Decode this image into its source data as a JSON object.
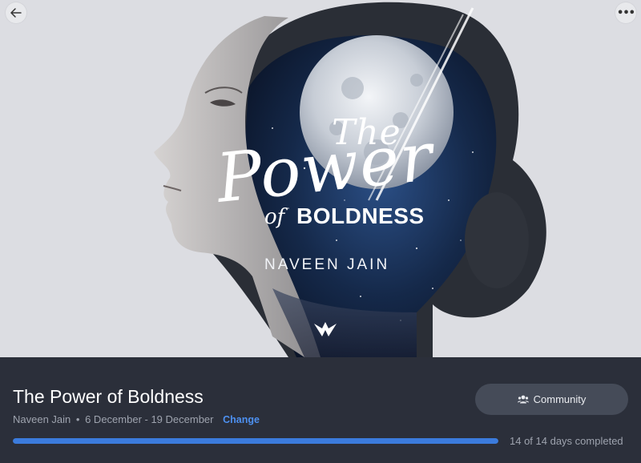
{
  "hero": {
    "art_title_the": "The",
    "art_title_power": "Power",
    "art_title_of": "of",
    "art_title_boldness": "BOLDNESS",
    "art_author": "NAVEEN JAIN",
    "back_icon": "arrow-left-icon",
    "more_icon": "more-horizontal-icon"
  },
  "course": {
    "title": "The Power of Boldness",
    "author": "Naveen Jain",
    "separator": "•",
    "dates": "6 December - 19 December",
    "change_label": "Change"
  },
  "community": {
    "label": "Community",
    "icon": "people-icon"
  },
  "progress": {
    "fraction": 1.0,
    "label": "14 of 14 days completed"
  },
  "colors": {
    "panel_bg": "#2b2f3a",
    "accent": "#3b7bdc",
    "link": "#4d90f0",
    "button_bg": "#454b58"
  }
}
